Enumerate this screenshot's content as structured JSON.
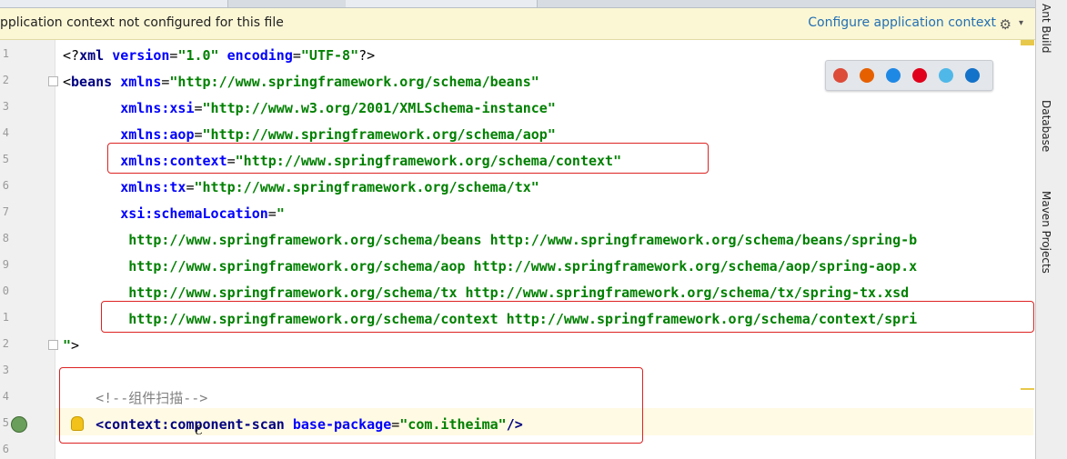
{
  "notice": {
    "message": "pplication context not configured for this file",
    "action_label": "Configure application context",
    "gear_icon": "gear-icon"
  },
  "gutter": {
    "line_numbers": [
      "1",
      "2",
      "3",
      "4",
      "5",
      "6",
      "7",
      "8",
      "9",
      "0",
      "1",
      "2",
      "3",
      "4",
      "5",
      "6"
    ]
  },
  "editor": {
    "lines": [
      {
        "open": "<?",
        "name": "xml",
        "rest": [
          {
            "c": "attr",
            "t": "version"
          },
          {
            "c": "pun",
            "t": "="
          },
          {
            "c": "val",
            "t": "\"1.0\""
          },
          {
            "c": "pun",
            "t": " "
          },
          {
            "c": "attr",
            "t": "encoding"
          },
          {
            "c": "pun",
            "t": "="
          },
          {
            "c": "val",
            "t": "\"UTF-8\""
          }
        ],
        "close": "?>"
      },
      {
        "open": "<",
        "name": "beans",
        "rest": [
          {
            "c": "pun",
            "t": " "
          },
          {
            "c": "attr",
            "t": "xmlns"
          },
          {
            "c": "pun",
            "t": "="
          },
          {
            "c": "val",
            "t": "\"http://www.springframework.org/schema/beans\""
          }
        ],
        "close": ""
      },
      {
        "indent": "       ",
        "rest": [
          {
            "c": "attr",
            "t": "xmlns:xsi"
          },
          {
            "c": "pun",
            "t": "="
          },
          {
            "c": "val",
            "t": "\"http://www.w3.org/2001/XMLSchema-instance\""
          }
        ]
      },
      {
        "indent": "       ",
        "rest": [
          {
            "c": "attr",
            "t": "xmlns:aop"
          },
          {
            "c": "pun",
            "t": "="
          },
          {
            "c": "val",
            "t": "\"http://www.springframework.org/schema/aop\""
          }
        ]
      },
      {
        "indent": "       ",
        "rest": [
          {
            "c": "attr",
            "t": "xmlns:context"
          },
          {
            "c": "pun",
            "t": "="
          },
          {
            "c": "val",
            "t": "\"http://www.springframework.org/schema/context\""
          }
        ]
      },
      {
        "indent": "       ",
        "rest": [
          {
            "c": "attr",
            "t": "xmlns:tx"
          },
          {
            "c": "pun",
            "t": "="
          },
          {
            "c": "val",
            "t": "\"http://www.springframework.org/schema/tx\""
          }
        ]
      },
      {
        "indent": "       ",
        "rest": [
          {
            "c": "attr",
            "t": "xsi:schemaLocation"
          },
          {
            "c": "pun",
            "t": "="
          },
          {
            "c": "val",
            "t": "\""
          }
        ]
      },
      {
        "indent": "        ",
        "rest": [
          {
            "c": "val",
            "t": "http://www.springframework.org/schema/beans http://www.springframework.org/schema/beans/spring-b"
          }
        ]
      },
      {
        "indent": "        ",
        "rest": [
          {
            "c": "val",
            "t": "http://www.springframework.org/schema/aop http://www.springframework.org/schema/aop/spring-aop.x"
          }
        ]
      },
      {
        "indent": "        ",
        "rest": [
          {
            "c": "val",
            "t": "http://www.springframework.org/schema/tx http://www.springframework.org/schema/tx/spring-tx.xsd"
          }
        ]
      },
      {
        "indent": "        ",
        "rest": [
          {
            "c": "val",
            "t": "http://www.springframework.org/schema/context http://www.springframework.org/schema/context/spri"
          }
        ]
      },
      {
        "indent": "",
        "rest": [
          {
            "c": "val",
            "t": "\""
          },
          {
            "c": "pun",
            "t": ">"
          }
        ]
      },
      {
        "indent": "",
        "rest": []
      },
      {
        "indent": "    ",
        "rest": [
          {
            "c": "cmt",
            "t": "<!--组件扫描-->"
          }
        ]
      },
      {
        "indent": "    ",
        "rest": [
          {
            "c": "tag",
            "t": "<context:component-scan"
          },
          {
            "c": "pun",
            "t": " "
          },
          {
            "c": "attr",
            "t": "base-package"
          },
          {
            "c": "pun",
            "t": "="
          },
          {
            "c": "val",
            "t": "\"com.itheima\""
          },
          {
            "c": "tag",
            "t": "/>"
          }
        ]
      },
      {
        "indent": "",
        "rest": []
      }
    ]
  },
  "browser_icons": [
    "chrome-icon",
    "firefox-icon",
    "safari-icon",
    "opera-icon",
    "ie-icon",
    "edge-icon"
  ],
  "right_panel": {
    "tabs": [
      "Ant Build",
      "Database",
      "Maven Projects"
    ]
  }
}
